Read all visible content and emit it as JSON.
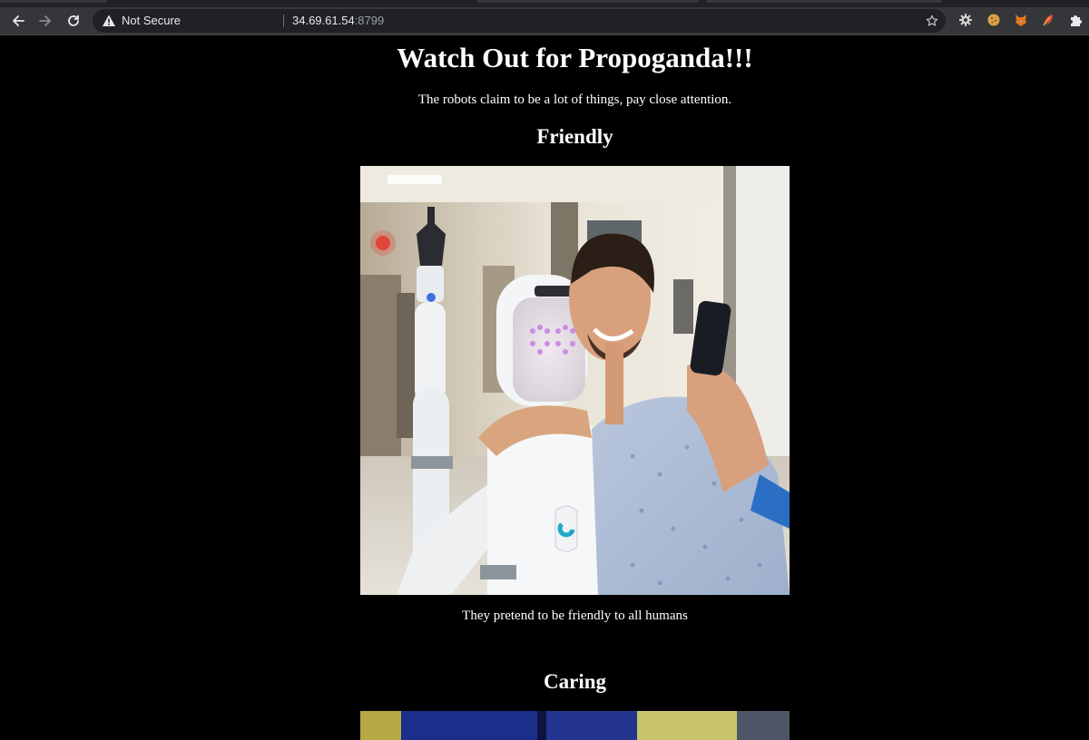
{
  "browser": {
    "security_label": "Not Secure",
    "url_host": "34.69.61.54",
    "url_port": ":8799",
    "icons": [
      "back-icon",
      "forward-icon",
      "reload-icon",
      "warning-icon",
      "bookmark-star-icon",
      "gear-extension-icon",
      "cookie-extension-icon",
      "fox-extension-icon",
      "feather-extension-icon",
      "puzzle-extensions-icon"
    ]
  },
  "page": {
    "title": "Watch Out for Propoganda!!!",
    "intro": "The robots claim to be a lot of things, pay close attention.",
    "sections": [
      {
        "heading": "Friendly",
        "image_alt": "robot and man in hospital gown taking a selfie",
        "caption": "They pretend to be friendly to all humans"
      },
      {
        "heading": "Caring",
        "image_alt": "hospital scene"
      }
    ]
  },
  "colors": {
    "page_bg": "#000000",
    "text": "#ffffff",
    "toolbar_bg": "#35363a",
    "omnibox_bg": "#202124"
  }
}
